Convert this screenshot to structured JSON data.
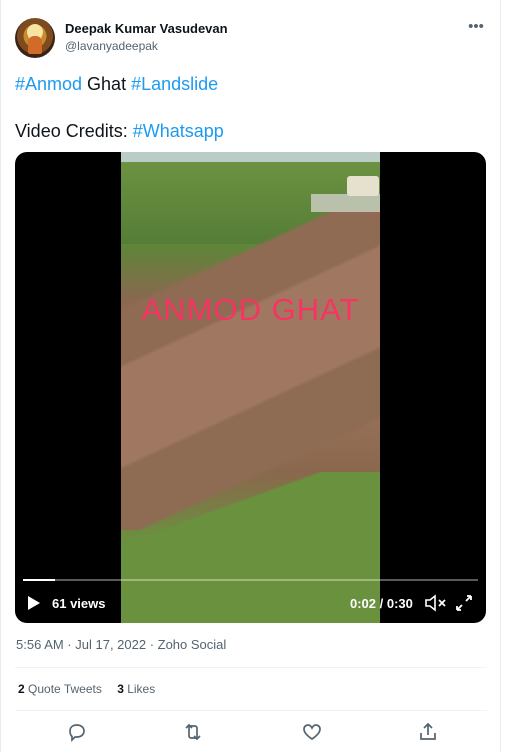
{
  "author": {
    "name": "Deepak Kumar Vasudevan",
    "handle": "@lavanyadeepak",
    "more_icon": "more-horizontal-icon"
  },
  "tweet": {
    "line1": {
      "tag1": "#Anmod",
      "word": " Ghat ",
      "tag2": "#Landslide"
    },
    "line2": {
      "prefix": "Video Credits: ",
      "tag": "#Whatsapp"
    },
    "hashtag_color": "#1d9bf0"
  },
  "video": {
    "overlay_text": "ANMOD GHAT",
    "views": "61 views",
    "time": "0:02 / 0:30",
    "progress": 0.07
  },
  "meta": "5:56 AM · Jul 17, 2022 · Zoho Social",
  "stats": {
    "quotes_count": "2",
    "quotes_label": " Quote Tweets",
    "likes_count": "3",
    "likes_label": " Likes"
  },
  "actions": [
    "reply-icon",
    "retweet-icon",
    "like-icon",
    "share-icon"
  ]
}
